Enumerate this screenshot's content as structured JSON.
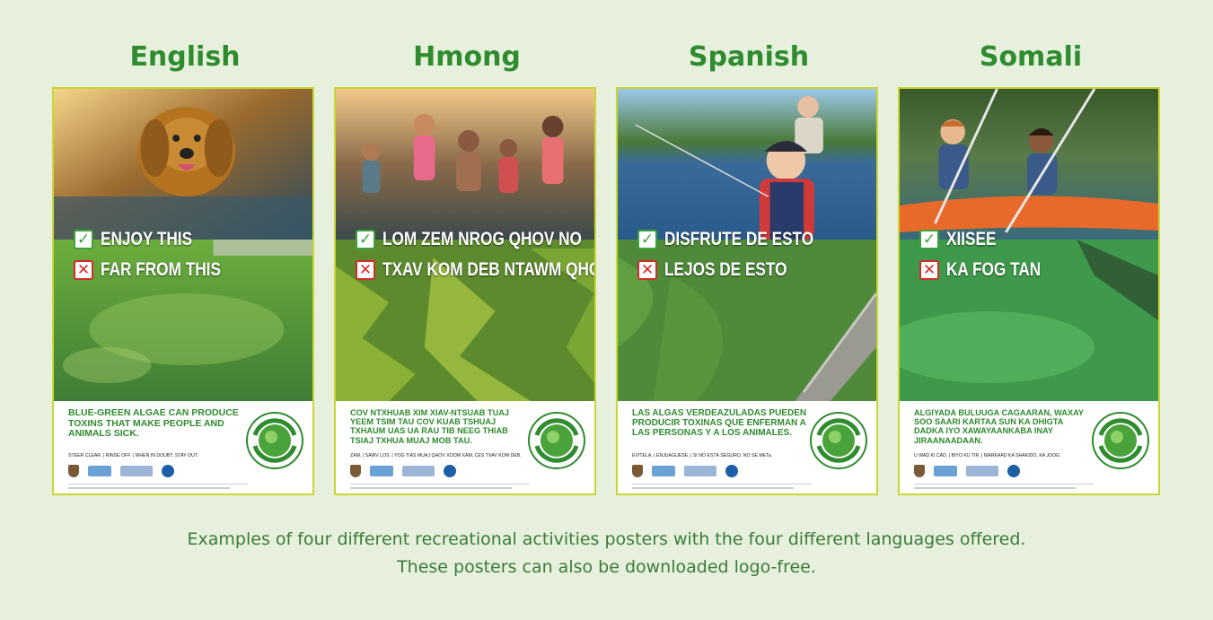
{
  "posters": [
    {
      "language": "English",
      "enjoy": "ENJOY THIS",
      "far": "FAR FROM THIS",
      "headline": "BLUE-GREEN ALGAE CAN PRODUCE TOXINS THAT MAKE PEOPLE AND ANIMALS SICK.",
      "sub": "STEER CLEAR.  |  RINSE OFF.  |  WHEN IN DOUBT, STAY OUT."
    },
    {
      "language": "Hmong",
      "enjoy": "LOM ZEM NROG QHOV NO",
      "far": "TXAV KOM DEB NTAWM QHOV NO",
      "headline": "COV NTXHUAB XIM XIAV-NTSUAB TUAJ YEEM TSIM TAU COV KUAB TSHUAJ TXHAUM UAS UA RAU TIB NEEG THIAB TSIAJ TXHUA MUAJ MOB TAU.",
      "sub": "ZAM.  |  SAWV LOS.  |  YOG TIAS MUAJ QHOV XOOM XAM, CES TXAV KOM DEB."
    },
    {
      "language": "Spanish",
      "enjoy": "DISFRUTE DE ESTO",
      "far": "LEJOS DE ESTO",
      "headline": "LAS ALGAS VERDEAZULADAS PUEDEN PRODUCIR TOXINAS QUE ENFERMAN A LAS PERSONAS Y A LOS ANIMALES.",
      "sub": "EVÍTELA.  |  ENJUÁGUESE.  |  SI NO ESTÁ SEGURO, NO SE METa."
    },
    {
      "language": "Somali",
      "enjoy": "XIISEE",
      "far": "KA FOG TAN",
      "headline": "ALGIYADA BULUUGA CAGAARAN, WAXAY SOO SAARI KARTAA SUN KA DHIGTA DADKA IYO XAWAYAANKABA INAY JIRAANAADAAN.",
      "sub": "U WAD KI CAD.  |  BIYO KU TIR.  |  MARKAAD KA SHAKIDO, KA JOOG."
    }
  ],
  "badge_text": "DON'T GET SICK · AVOID THE ICK",
  "caption_line1": "Examples of four different recreational activities posters with the four different languages offered.",
  "caption_line2": "These posters can also be downloaded logo-free.",
  "colors": {
    "background": "#e6f0dc",
    "label_green": "#2e8b2e",
    "poster_border": "#c8d636",
    "caption_green": "#3d7a3d"
  }
}
